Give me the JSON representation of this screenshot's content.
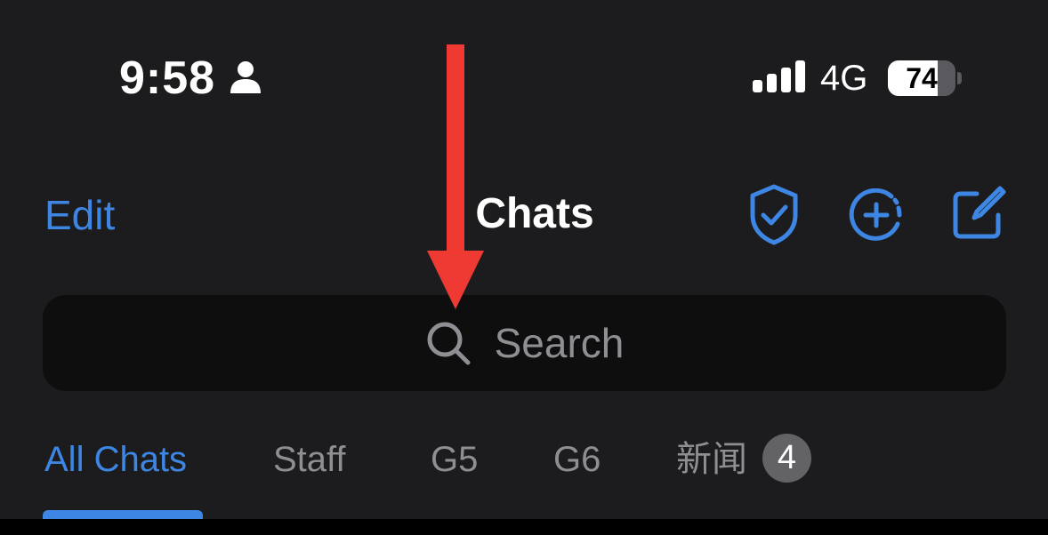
{
  "status_bar": {
    "time": "9:58",
    "network": "4G",
    "battery_level": "74",
    "battery_percent": 74,
    "signal_bars": 4,
    "person_icon": "person-icon",
    "signal_icon": "cellular-signal-icon",
    "battery_icon": "battery-icon"
  },
  "nav": {
    "edit_label": "Edit",
    "title": "Chats",
    "icons": [
      "shield-check-icon",
      "add-story-icon",
      "compose-icon"
    ]
  },
  "search": {
    "placeholder": "Search",
    "icon": "search-icon"
  },
  "tabs": {
    "items": [
      {
        "label": "All Chats",
        "active": true
      },
      {
        "label": "Staff",
        "active": false
      },
      {
        "label": "G5",
        "active": false
      },
      {
        "label": "G6",
        "active": false
      },
      {
        "label": "新闻",
        "active": false,
        "badge": "4"
      }
    ]
  },
  "annotation": {
    "type": "arrow-down",
    "color": "#ee3a33"
  },
  "colors": {
    "background": "#1c1c1e",
    "accent": "#3e86e4",
    "search_bg": "#0e0e0f",
    "muted_text": "#8e8e93",
    "badge_bg": "#636366"
  }
}
